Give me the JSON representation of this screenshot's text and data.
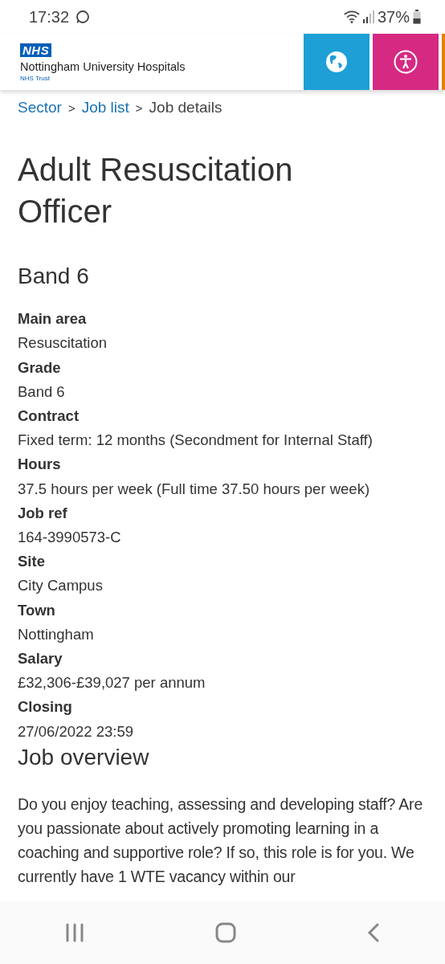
{
  "status_bar": {
    "time": "17:32",
    "battery": "37%"
  },
  "header": {
    "logo_badge": "NHS",
    "org_name": "Nottingham University Hospitals",
    "org_sub": "NHS Trust"
  },
  "breadcrumb": [
    {
      "label": "Sector",
      "link": true
    },
    {
      "label": "Job list",
      "link": true
    },
    {
      "label": "Job details",
      "link": false
    }
  ],
  "breadcrumb_separator": ">",
  "job": {
    "title": "Adult Resuscitation Officer",
    "band": "Band 6",
    "details": [
      {
        "label": "Main area",
        "value": "Resuscitation"
      },
      {
        "label": "Grade",
        "value": "Band 6"
      },
      {
        "label": "Contract",
        "value": "Fixed term: 12 months (Secondment for Internal Staff)"
      },
      {
        "label": "Hours",
        "value": "37.5 hours per week (Full time 37.50 hours per week)"
      },
      {
        "label": "Job ref",
        "value": "164-3990573-C"
      },
      {
        "label": "Site",
        "value": "City Campus"
      },
      {
        "label": "Town",
        "value": "Nottingham"
      },
      {
        "label": "Salary",
        "value": "£32,306-£39,027 per annum"
      },
      {
        "label": "Closing",
        "value": "27/06/2022 23:59"
      }
    ],
    "overview_heading": "Job overview",
    "overview_text": "Do you enjoy teaching, assessing and developing staff? Are you passionate about actively promoting learning in a coaching and supportive role? If so, this role is for you. We currently have 1 WTE vacancy within our"
  }
}
